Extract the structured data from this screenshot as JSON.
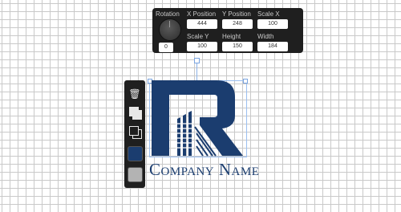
{
  "properties_panel": {
    "rotation": {
      "label": "Rotation",
      "value": "0"
    },
    "x_position": {
      "label": "X Position",
      "value": "444"
    },
    "y_position": {
      "label": "Y Position",
      "value": "248"
    },
    "scale_x": {
      "label": "Scale X",
      "value": "100"
    },
    "scale_y": {
      "label": "Scale Y",
      "value": "100"
    },
    "height": {
      "label": "Height",
      "value": "150"
    },
    "width": {
      "label": "Width",
      "value": "184"
    }
  },
  "toolbar": {
    "icons": [
      "trash-icon",
      "bring-to-front-icon",
      "send-to-back-icon"
    ],
    "swatches": [
      "#1b3d6f",
      "#b3b3b3"
    ]
  },
  "logo": {
    "letter": "R",
    "company_name": "Company Name",
    "color": "#1b3d6f"
  }
}
